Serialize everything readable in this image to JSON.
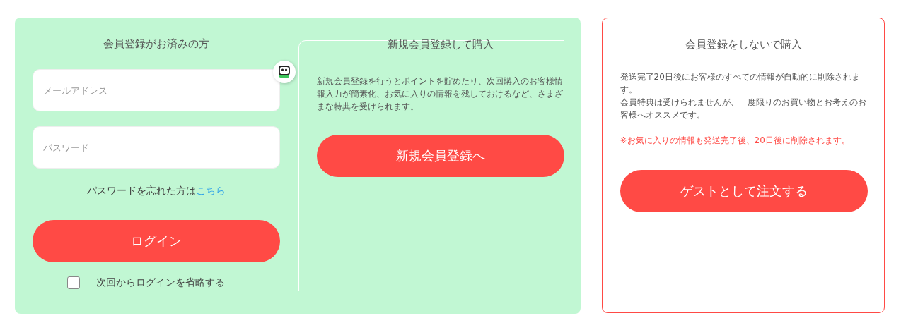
{
  "member_login": {
    "title": "会員登録がお済みの方",
    "email_field": {
      "placeholder": "メールアドレス"
    },
    "password_field": {
      "placeholder": "パスワード"
    },
    "forgot_text": "パスワードを忘れた方は",
    "forgot_link": "こちら",
    "login_button": "ログイン",
    "remember": {
      "label": "次回からログインを省略する",
      "checked": false
    }
  },
  "new_member": {
    "title": "新規会員登録して購入",
    "description": "新規会員登録を行うとポイントを貯めたり、次回購入のお客様情報入力が簡素化、お気に入りの情報を残しておけるなど、さまざまな特典を受けられます。",
    "button": "新規会員登録へ"
  },
  "guest": {
    "title": "会員登録をしないで購入",
    "paragraphs": [
      {
        "kind": "normal",
        "text": "発送完了20日後にお客様のすべての情報が自動的に削除されます。"
      },
      {
        "kind": "normal",
        "text": "会員特典は受けられませんが、一度限りのお買い物とお考えのお客様へオススメです。"
      },
      {
        "kind": "warning",
        "text": "※お気に入りの情報も発送完了後、20日後に削除されます。"
      }
    ],
    "button": "ゲストとして注文する"
  }
}
